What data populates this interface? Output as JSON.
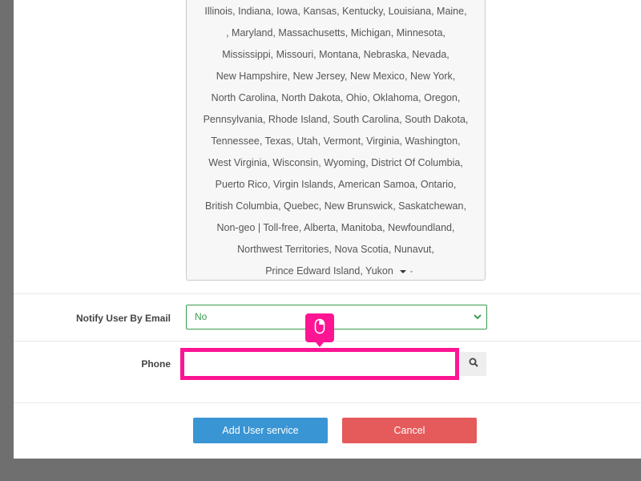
{
  "states_list": {
    "items": [
      "Illinois",
      "Indiana",
      "Iowa",
      "Kansas",
      "Kentucky",
      "Louisiana",
      "Maine",
      "Maryland",
      "Massachusetts",
      "Michigan",
      "Minnesota",
      "Mississippi",
      "Missouri",
      "Montana",
      "Nebraska",
      "Nevada",
      "New Hampshire",
      "New Jersey",
      "New Mexico",
      "New York",
      "North Carolina",
      "North Dakota",
      "Ohio",
      "Oklahoma",
      "Oregon",
      "Pennsylvania",
      "Rhode Island",
      "South Carolina",
      "South Dakota",
      "Tennessee",
      "Texas",
      "Utah",
      "Vermont",
      "Virginia",
      "Washington",
      "West Virginia",
      "Wisconsin",
      "Wyoming",
      "District Of Columbia",
      "Puerto Rico",
      "Virgin Islands",
      "American Samoa",
      "Ontario",
      "British Columbia",
      "Quebec",
      "New Brunswick",
      "Saskatchewan",
      "Non-geo | Toll-free",
      "Alberta",
      "Manitoba",
      "Newfoundland",
      "Northwest Territories",
      "Nova Scotia",
      "Nunavut",
      "Prince Edward Island",
      "Yukon"
    ],
    "rows": [
      [
        "Illinois",
        "Indiana",
        "Iowa",
        "Kansas",
        "Kentucky",
        "Louisiana",
        "Maine"
      ],
      [
        ", Maryland",
        "Massachusetts",
        "Michigan",
        "Minnesota"
      ],
      [
        "Mississippi",
        "Missouri",
        "Montana",
        "Nebraska",
        "Nevada"
      ],
      [
        "New Hampshire",
        "New Jersey",
        "New Mexico",
        "New York"
      ],
      [
        "North Carolina",
        "North Dakota",
        "Ohio",
        "Oklahoma",
        "Oregon"
      ],
      [
        "Pennsylvania",
        "Rhode Island",
        "South Carolina",
        "South Dakota"
      ],
      [
        "Tennessee",
        "Texas",
        "Utah",
        "Vermont",
        "Virginia",
        "Washington"
      ],
      [
        "West Virginia",
        "Wisconsin",
        "Wyoming",
        "District Of Columbia"
      ],
      [
        "Puerto Rico",
        "Virgin Islands",
        "American Samoa",
        "Ontario"
      ],
      [
        "British Columbia",
        "Quebec",
        "New Brunswick",
        "Saskatchewan"
      ],
      [
        "Non-geo | Toll-free",
        "Alberta",
        "Manitoba",
        "Newfoundland"
      ],
      [
        "Northwest Territories",
        "Nova Scotia",
        "Nunavut"
      ],
      [
        "Prince Edward Island",
        "Yukon"
      ]
    ],
    "row_trailing_commas": [
      true,
      true,
      true,
      true,
      true,
      true,
      true,
      true,
      true,
      true,
      true,
      true,
      false
    ]
  },
  "notify": {
    "label": "Notify User By Email",
    "selected": "No"
  },
  "phone": {
    "label": "Phone",
    "value": "",
    "placeholder": ""
  },
  "buttons": {
    "add_label": "Add User service",
    "cancel_label": "Cancel"
  },
  "icons": {
    "search": "search-icon",
    "mouse": "mouse-cursor-icon",
    "dropdown": "chevron-down-icon"
  },
  "colors": {
    "add_button": "#3a95d4",
    "cancel_button": "#e55a5a",
    "highlight": "#ff1493",
    "select_border": "#3a9c4e"
  }
}
